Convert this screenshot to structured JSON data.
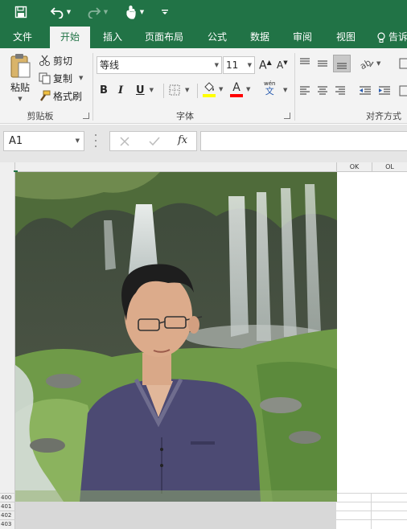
{
  "qat": {
    "icons": [
      "save-icon",
      "undo-icon",
      "redo-icon",
      "touch-mode-icon",
      "customize-qat-icon"
    ]
  },
  "tabs": [
    {
      "label": "文件"
    },
    {
      "label": "开始"
    },
    {
      "label": "插入"
    },
    {
      "label": "页面布局"
    },
    {
      "label": "公式"
    },
    {
      "label": "数据"
    },
    {
      "label": "审阅"
    },
    {
      "label": "视图"
    }
  ],
  "tell_me": {
    "label": "告诉"
  },
  "clipboard": {
    "paste_label": "粘贴",
    "cut_label": "剪切",
    "copy_label": "复制",
    "format_painter_label": "格式刷",
    "group_label": "剪贴板"
  },
  "font": {
    "font_name": "等线",
    "font_size": "11",
    "bold_label": "B",
    "italic_label": "I",
    "underline_label": "U",
    "font_color_letter": "A",
    "phonetic_label": "wén",
    "phonetic_char": "文",
    "group_label": "字体"
  },
  "alignment": {
    "group_label": "对齐方式"
  },
  "formula_bar": {
    "name_box": "A1",
    "fx_label": "fx",
    "formula": ""
  },
  "grid": {
    "columns": [
      "OK",
      "OL"
    ],
    "rows": [
      "400",
      "401",
      "402",
      "403"
    ]
  },
  "colors": {
    "brand": "#217346",
    "ribbon_bg": "#f3f3f3",
    "highlight": "#ffff00",
    "font_color": "#ff0000"
  }
}
